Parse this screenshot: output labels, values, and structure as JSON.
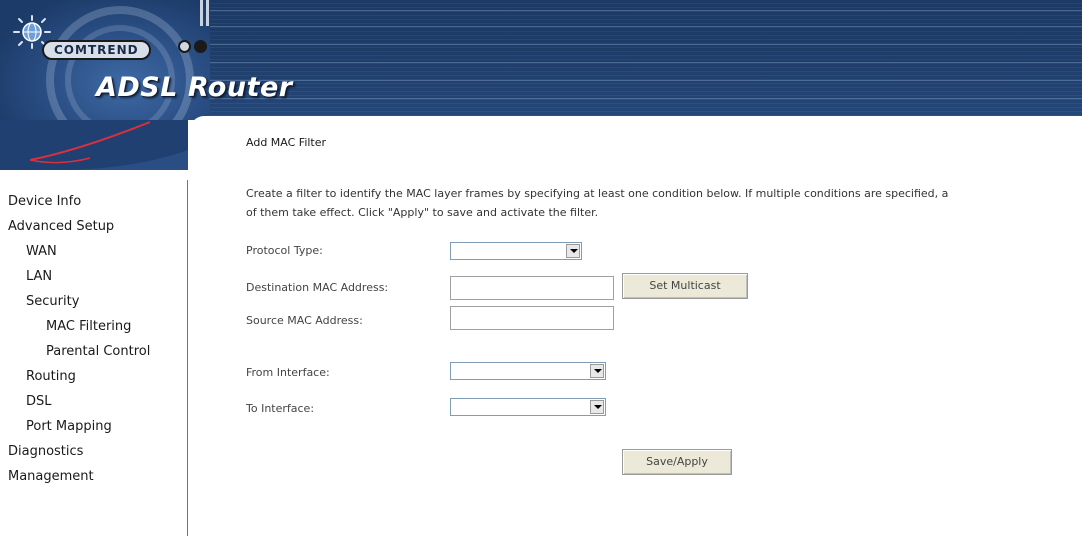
{
  "header": {
    "brand": "COMTREND",
    "title": "ADSL Router"
  },
  "sidebar": {
    "items": [
      {
        "label": "Device Info",
        "level": 1
      },
      {
        "label": "Advanced Setup",
        "level": 1
      },
      {
        "label": "WAN",
        "level": 2
      },
      {
        "label": "LAN",
        "level": 2
      },
      {
        "label": "Security",
        "level": 2
      },
      {
        "label": "MAC Filtering",
        "level": 3
      },
      {
        "label": "Parental Control",
        "level": 3
      },
      {
        "label": "Routing",
        "level": 2
      },
      {
        "label": "DSL",
        "level": 2
      },
      {
        "label": "Port Mapping",
        "level": 2
      },
      {
        "label": "Diagnostics",
        "level": 1
      },
      {
        "label": "Management",
        "level": 1
      }
    ]
  },
  "main": {
    "title": "Add MAC Filter",
    "description_line1": "Create a filter to identify the MAC layer frames by specifying at least one condition below. If multiple conditions are specified, a",
    "description_line2": "of them take effect. Click \"Apply\" to save and activate the filter.",
    "form": {
      "protocol_type_label": "Protocol Type:",
      "protocol_type_value": "",
      "dest_mac_label": "Destination MAC Address:",
      "dest_mac_value": "",
      "set_multicast_label": "Set Multicast",
      "source_mac_label": "Source MAC Address:",
      "source_mac_value": "",
      "from_interface_label": "From Interface:",
      "from_interface_value": "",
      "to_interface_label": "To Interface:",
      "to_interface_value": "",
      "save_apply_label": "Save/Apply"
    }
  }
}
